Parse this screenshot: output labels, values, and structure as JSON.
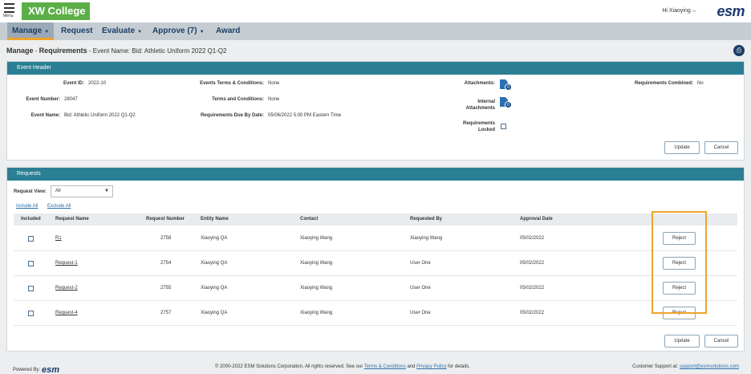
{
  "topbar": {
    "menu_label": "Menu",
    "logo_text": "XW College",
    "greeting": "Hi Xiaoying ⌵",
    "brand": "esm"
  },
  "nav": {
    "items": [
      {
        "label": "Manage"
      },
      {
        "label": "Request"
      },
      {
        "label": "Evaluate"
      },
      {
        "label": "Approve (7)"
      },
      {
        "label": "Award"
      }
    ]
  },
  "page": {
    "title_part1": "Manage",
    "title_part2": "Requirements",
    "subtitle": "Event Name: Bid: Athletic Uniform 2022 Q1-Q2"
  },
  "event_header": {
    "title": "Event Header",
    "event_id_label": "Event ID:",
    "event_id": "2022-10",
    "event_number_label": "Event Number:",
    "event_number": "28047",
    "event_name_label": "Event Name:",
    "event_name": "Bid: Athletic Uniform 2022 Q1-Q2",
    "terms_label": "Events Terms & Conditions:",
    "terms_value": "None",
    "tc_label": "Terms and Conditions:",
    "tc_value": "None",
    "due_label": "Requirements Due By Date:",
    "due_value": "05/06/2022 5:00 PM Eastern Time",
    "attachments_label": "Attachments:",
    "attachments_count": "0",
    "internal_label_1": "Internal",
    "internal_label_2": "Attachments",
    "internal_count": "0",
    "locked_label_1": "Requirements",
    "locked_label_2": "Locked",
    "combined_label": "Requirements Combined:",
    "combined_value": "No",
    "update_label": "Update",
    "cancel_label": "Cancel"
  },
  "requests": {
    "title": "Requests",
    "view_label": "Request View:",
    "view_value": "All",
    "include_all": "Include All",
    "exclude_all": "Exclude All",
    "columns": [
      "Included",
      "Request Name",
      "Request Number",
      "Entity Name",
      "Contact",
      "Requested By",
      "Approval Date"
    ],
    "rows": [
      {
        "name": "R1",
        "number": "2758",
        "entity": "Xiaoying QA",
        "contact": "Xiaoying Wang",
        "requested_by": "Xiaoying Wang",
        "date": "05/02/2022",
        "action": "Reject"
      },
      {
        "name": "Request-1",
        "number": "2754",
        "entity": "Xiaoying QA",
        "contact": "Xiaoying Wang",
        "requested_by": "User One",
        "date": "05/02/2022",
        "action": "Reject"
      },
      {
        "name": "Request-2",
        "number": "2755",
        "entity": "Xiaoying QA",
        "contact": "Xiaoying Wang",
        "requested_by": "User One",
        "date": "05/02/2022",
        "action": "Reject"
      },
      {
        "name": "Request-4",
        "number": "2757",
        "entity": "Xiaoying QA",
        "contact": "Xiaoying Wang",
        "requested_by": "User One",
        "date": "05/02/2022",
        "action": "Reject"
      }
    ],
    "update_label": "Update",
    "cancel_label": "Cancel"
  },
  "footer": {
    "powered_by": "Powered By:",
    "brand": "esm",
    "copyright_pre": "© 2000-2022 ESM Solutions Corporation, All rights reserved. See our",
    "terms_link": "Terms & Conditions",
    "and": "and",
    "privacy_link": "Privacy Policy",
    "copyright_post": "for details.",
    "support_label": "Customer Support at:",
    "support_email": "support@esmsolutions.com"
  },
  "colors": {
    "brand_green": "#5cae47",
    "panel_header": "#2a7f94",
    "nav_bg": "#c5cdd3",
    "highlight": "#f0a32a",
    "navy": "#1a3b6e"
  }
}
